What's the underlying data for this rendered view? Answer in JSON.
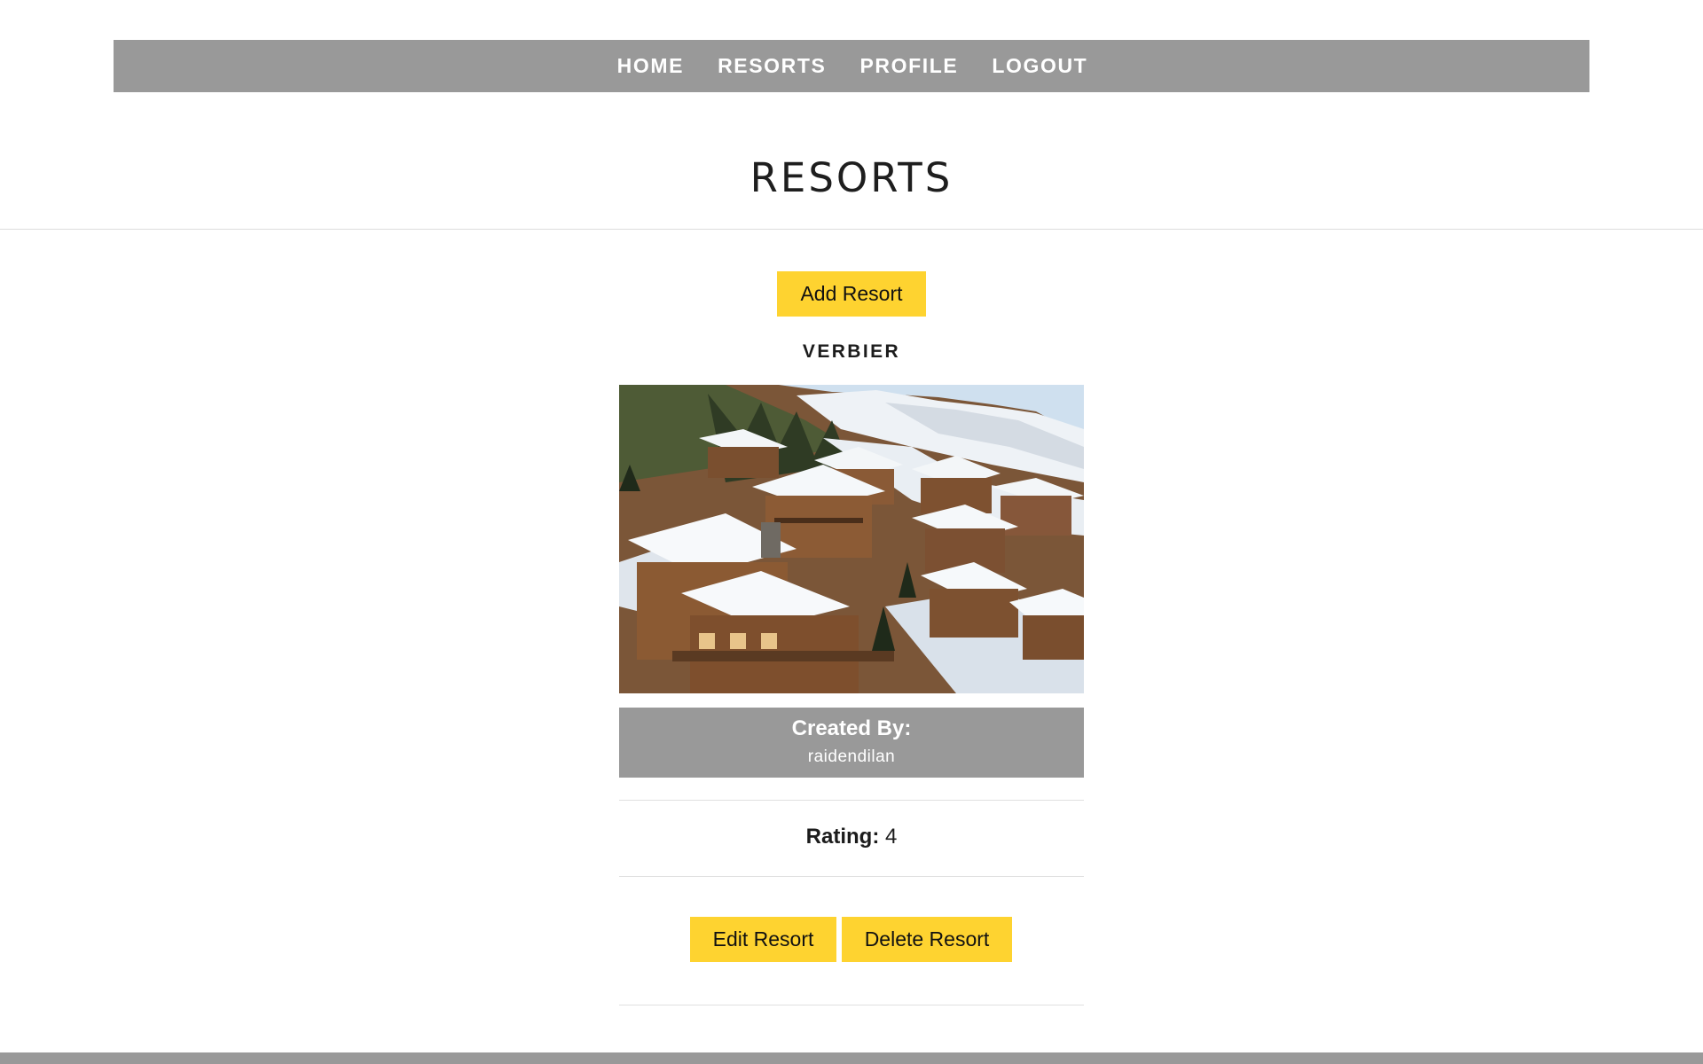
{
  "nav": {
    "items": [
      "HOME",
      "RESORTS",
      "PROFILE",
      "LOGOUT"
    ]
  },
  "page": {
    "title": "RESORTS",
    "add_button_label": "Add Resort"
  },
  "resort": {
    "name": "VERBIER",
    "image_alt": "chalet-village-photo",
    "created_by_label": "Created By:",
    "created_by_user": "raidendilan",
    "rating_label": "Rating:",
    "rating_value": "4",
    "edit_button_label": "Edit Resort",
    "delete_button_label": "Delete Resort"
  },
  "colors": {
    "nav_background": "#999999",
    "button_yellow": "#fed330",
    "text_dark": "#1c1c1c",
    "white": "#ffffff"
  }
}
